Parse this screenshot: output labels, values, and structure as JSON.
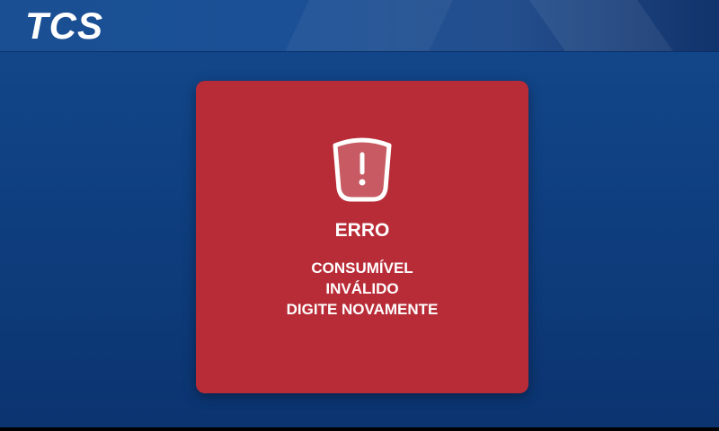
{
  "header": {
    "logo_text": "TCS"
  },
  "dialog": {
    "icon": "shield-alert-icon",
    "title": "ERRO",
    "message_lines": [
      "CONSUMÍVEL",
      "INVÁLIDO",
      "DIGITE NOVAMENTE"
    ]
  },
  "colors": {
    "background": "#0f3f80",
    "header": "#1b5096",
    "dialog": "#b82c37",
    "text": "#ffffff"
  }
}
